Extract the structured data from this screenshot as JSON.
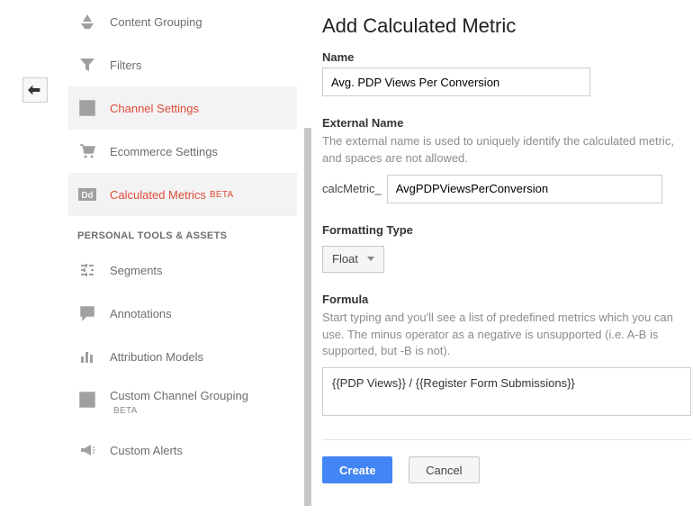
{
  "sidebar": {
    "items": [
      {
        "label": "Content Grouping",
        "active": false
      },
      {
        "label": "Filters",
        "active": false
      },
      {
        "label": "Channel Settings",
        "active": true
      },
      {
        "label": "Ecommerce Settings",
        "active": false
      },
      {
        "label": "Calculated Metrics",
        "beta": "BETA",
        "active": true
      }
    ],
    "section_header": "PERSONAL TOOLS & ASSETS",
    "tools": [
      {
        "label": "Segments"
      },
      {
        "label": "Annotations"
      },
      {
        "label": "Attribution Models"
      },
      {
        "label": "Custom Channel Grouping",
        "beta": "BETA"
      },
      {
        "label": "Custom Alerts"
      }
    ]
  },
  "main": {
    "title": "Add Calculated Metric",
    "name_label": "Name",
    "name_value": "Avg. PDP Views Per Conversion",
    "external_label": "External Name",
    "external_help": "The external name is used to uniquely identify the calculated metric, and spaces are not allowed.",
    "external_prefix": "calcMetric_",
    "external_value": "AvgPDPViewsPerConversion",
    "fmt_label": "Formatting Type",
    "fmt_value": "Float",
    "formula_label": "Formula",
    "formula_help": "Start typing and you'll see a list of predefined metrics which you can use. The minus operator as a negative is unsupported (i.e. A-B is supported, but -B is not).",
    "formula_value": "{{PDP Views}} / {{Register Form Submissions}}",
    "create_label": "Create",
    "cancel_label": "Cancel"
  }
}
